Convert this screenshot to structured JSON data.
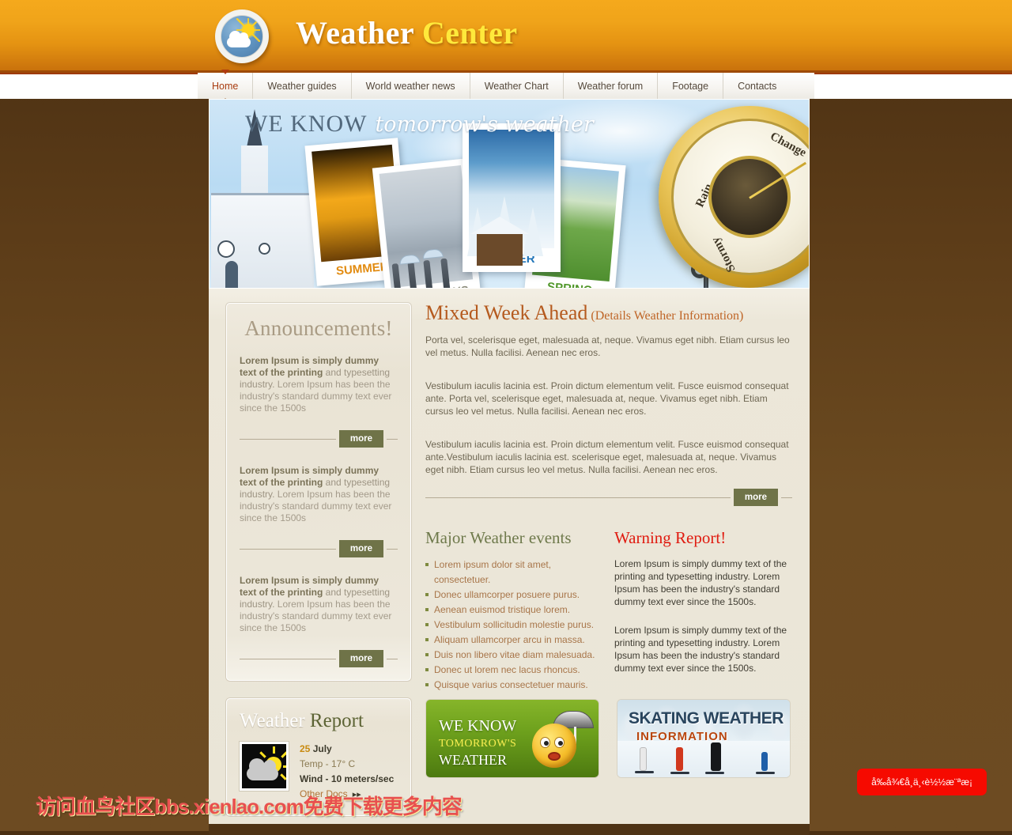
{
  "header": {
    "title_part1": "Weather",
    "title_part2": "Center",
    "logo_icon": "sun-cloud-logo-icon"
  },
  "nav": {
    "items": [
      {
        "label": "Home",
        "active": true
      },
      {
        "label": "Weather guides",
        "active": false
      },
      {
        "label": "World weather news",
        "active": false
      },
      {
        "label": "Weather Chart",
        "active": false
      },
      {
        "label": "Weather forum",
        "active": false
      },
      {
        "label": "Footage",
        "active": false
      },
      {
        "label": "Contacts",
        "active": false
      }
    ]
  },
  "hero": {
    "headline_plain": "WE KNOW",
    "headline_script": "tomorrow's weather",
    "photos": [
      {
        "caption": "SUMMER"
      },
      {
        "caption": "RAINY DAYS"
      },
      {
        "caption": "WINTER"
      },
      {
        "caption": "SPRING"
      }
    ],
    "barometer": {
      "label_change": "Change",
      "label_rain": "Rain",
      "label_stormy": "Stormy"
    }
  },
  "announcements": {
    "title": "Announcements!",
    "items": [
      {
        "bold": "Lorem Ipsum is simply dummy text of the printing",
        "mid": " and typesetting industry.",
        "rest": " Lorem Ipsum has been the industry's standard dummy text ever since the 1500s",
        "more_label": "more"
      },
      {
        "bold": "Lorem Ipsum is simply dummy text of the printing",
        "mid": " and typesetting industry.",
        "rest": " Lorem Ipsum has been the industry's standard dummy text ever since the 1500s",
        "more_label": "more"
      },
      {
        "bold": "Lorem Ipsum is simply dummy text of the printing",
        "mid": " and typesetting industry.",
        "rest": " Lorem Ipsum has been the industry's standard dummy text ever since the 1500s",
        "more_label": "more"
      }
    ]
  },
  "weather_report": {
    "title_white": "Weather",
    "title_green": "Report",
    "icon": "sun-behind-cloud-icon",
    "date_day": "25",
    "date_month": "July",
    "temp": "Temp - 17° C",
    "wind": "Wind - 10 meters/sec",
    "other_docs": "Other Docs",
    "other_docs_arrow": "▸▸"
  },
  "main": {
    "heading": "Mixed Week Ahead",
    "subheading": "(Details Weather Information)",
    "paragraph1": "Porta vel, scelerisque eget, malesuada at, neque. Vivamus eget nibh. Etiam cursus leo vel metus. Nulla facilisi. Aenean nec eros.",
    "paragraph2": "Vestibulum iaculis lacinia est. Proin dictum elementum velit. Fusce euismod consequat ante. Porta vel, scelerisque eget, malesuada at, neque. Vivamus eget nibh. Etiam cursus leo vel metus. Nulla facilisi. Aenean nec eros.",
    "paragraph3": "Vestibulum iaculis lacinia est. Proin dictum elementum velit. Fusce euismod consequat ante.Vestibulum iaculis lacinia est. scelerisque eget, malesuada at, neque. Vivamus eget nibh. Etiam cursus leo vel metus. Nulla facilisi. Aenean nec eros.",
    "more_label": "more"
  },
  "events": {
    "title": "Major Weather events",
    "items": [
      "Lorem ipsum dolor sit amet, consectetuer.",
      "Donec ullamcorper posuere purus.",
      "Aenean euismod tristique lorem.",
      "Vestibulum sollicitudin molestie purus.",
      "Aliquam ullamcorper arcu in massa.",
      "Duis non libero vitae diam malesuada.",
      "Donec ut lorem nec lacus rhoncus.",
      "Quisque varius consectetuer mauris."
    ]
  },
  "warning": {
    "title": "Warning Report!",
    "paragraph1": "Lorem Ipsum is simply dummy text of the printing and typesetting industry. Lorem Ipsum has been the industry's standard dummy text ever since the 1500s.",
    "paragraph2": "Lorem Ipsum is simply dummy text of the printing and typesetting industry. Lorem Ipsum has been the industry's standard dummy text ever since the 1500s."
  },
  "banners": {
    "green": {
      "line1": "WE KNOW",
      "line2": "TOMORROW'S",
      "line3": "WEATHER",
      "icon": "smiley-with-umbrella-icon"
    },
    "ski": {
      "line1": "SKATING WEATHER",
      "line2": "INFORMATION"
    }
  },
  "overlays": {
    "watermark": "访问血鸟社区bbs.xienlao.com免费下载更多内容",
    "badge": "å‰å¾€å¸ä¸‹è½½æ¨ªæ¡"
  }
}
